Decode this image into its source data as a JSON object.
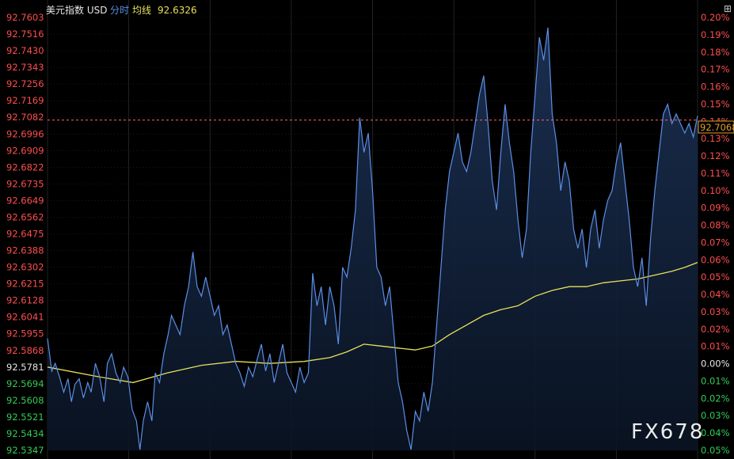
{
  "header": {
    "instrument": "美元指数 USD",
    "mode": "分时",
    "avg_label": "均线",
    "avg_value": "92.6326",
    "button_glyph": "⊞"
  },
  "colors": {
    "background": "#000000",
    "price_line": "#5b8ee6",
    "avg_line": "#e8e05a",
    "up_text": "#ff4d4d",
    "down_text": "#33cc55",
    "neutral_text": "#e6e6e6",
    "grid": "#2a2a2a",
    "ref_line": "#ff6b6b",
    "current_badge": "#e0a028"
  },
  "watermark": "FX678",
  "chart_data": {
    "type": "area",
    "title": "",
    "base_price": 92.5781,
    "current_price": "92.7068",
    "ylim": [
      92.5347,
      92.7603
    ],
    "left_ticks": [
      "92.7603",
      "92.7516",
      "92.7430",
      "92.7343",
      "92.7256",
      "92.7169",
      "92.7082",
      "92.6996",
      "92.6909",
      "92.6822",
      "92.6735",
      "92.6649",
      "92.6562",
      "92.6475",
      "92.6388",
      "92.6302",
      "92.6215",
      "92.6128",
      "92.6041",
      "92.5955",
      "92.5868",
      "92.5781",
      "92.5694",
      "92.5608",
      "92.5521",
      "92.5434",
      "92.5347"
    ],
    "right_ticks": [
      "0.20%",
      "0.19%",
      "0.18%",
      "0.17%",
      "0.16%",
      "0.15%",
      "0.14%",
      "0.13%",
      "0.12%",
      "0.11%",
      "0.10%",
      "0.09%",
      "0.08%",
      "0.07%",
      "0.06%",
      "0.05%",
      "0.04%",
      "0.03%",
      "0.02%",
      "0.01%",
      "0.00%",
      "0.01%",
      "0.02%",
      "0.03%",
      "0.04%",
      "0.05%"
    ],
    "series": [
      {
        "key": "price",
        "points": [
          [
            0,
            92.593
          ],
          [
            5,
            92.576
          ],
          [
            9,
            92.58
          ],
          [
            14,
            92.573
          ],
          [
            19,
            92.565
          ],
          [
            24,
            92.572
          ],
          [
            28,
            92.56
          ],
          [
            32,
            92.569
          ],
          [
            37,
            92.572
          ],
          [
            42,
            92.562
          ],
          [
            47,
            92.57
          ],
          [
            51,
            92.565
          ],
          [
            56,
            92.58
          ],
          [
            61,
            92.573
          ],
          [
            66,
            92.56
          ],
          [
            70,
            92.58
          ],
          [
            75,
            92.585
          ],
          [
            80,
            92.575
          ],
          [
            85,
            92.57
          ],
          [
            89,
            92.578
          ],
          [
            94,
            92.573
          ],
          [
            99,
            92.556
          ],
          [
            104,
            92.55
          ],
          [
            108,
            92.535
          ],
          [
            112,
            92.55
          ],
          [
            117,
            92.56
          ],
          [
            122,
            92.55
          ],
          [
            126,
            92.575
          ],
          [
            131,
            92.57
          ],
          [
            136,
            92.585
          ],
          [
            141,
            92.595
          ],
          [
            145,
            92.605
          ],
          [
            150,
            92.6
          ],
          [
            155,
            92.595
          ],
          [
            160,
            92.61
          ],
          [
            165,
            92.62
          ],
          [
            170,
            92.638
          ],
          [
            175,
            92.62
          ],
          [
            180,
            92.615
          ],
          [
            185,
            92.625
          ],
          [
            190,
            92.615
          ],
          [
            195,
            92.605
          ],
          [
            200,
            92.61
          ],
          [
            205,
            92.595
          ],
          [
            210,
            92.6
          ],
          [
            215,
            92.59
          ],
          [
            220,
            92.58
          ],
          [
            225,
            92.575
          ],
          [
            230,
            92.568
          ],
          [
            235,
            92.578
          ],
          [
            240,
            92.573
          ],
          [
            245,
            92.582
          ],
          [
            250,
            92.59
          ],
          [
            255,
            92.576
          ],
          [
            260,
            92.585
          ],
          [
            265,
            92.57
          ],
          [
            270,
            92.58
          ],
          [
            275,
            92.59
          ],
          [
            280,
            92.575
          ],
          [
            285,
            92.57
          ],
          [
            290,
            92.565
          ],
          [
            295,
            92.578
          ],
          [
            300,
            92.57
          ],
          [
            305,
            92.575
          ],
          [
            310,
            92.627
          ],
          [
            315,
            92.61
          ],
          [
            320,
            92.62
          ],
          [
            325,
            92.6
          ],
          [
            330,
            92.62
          ],
          [
            335,
            92.61
          ],
          [
            340,
            92.59
          ],
          [
            345,
            92.63
          ],
          [
            350,
            92.625
          ],
          [
            355,
            92.64
          ],
          [
            360,
            92.66
          ],
          [
            365,
            92.708
          ],
          [
            370,
            92.69
          ],
          [
            375,
            92.7
          ],
          [
            380,
            92.67
          ],
          [
            385,
            92.63
          ],
          [
            390,
            92.625
          ],
          [
            395,
            92.61
          ],
          [
            400,
            92.62
          ],
          [
            405,
            92.595
          ],
          [
            410,
            92.57
          ],
          [
            415,
            92.56
          ],
          [
            420,
            92.545
          ],
          [
            425,
            92.535
          ],
          [
            430,
            92.555
          ],
          [
            435,
            92.55
          ],
          [
            440,
            92.565
          ],
          [
            445,
            92.555
          ],
          [
            450,
            92.57
          ],
          [
            455,
            92.6
          ],
          [
            460,
            92.63
          ],
          [
            465,
            92.66
          ],
          [
            470,
            92.68
          ],
          [
            475,
            92.69
          ],
          [
            480,
            92.7
          ],
          [
            485,
            92.685
          ],
          [
            490,
            92.68
          ],
          [
            495,
            92.69
          ],
          [
            500,
            92.705
          ],
          [
            505,
            92.72
          ],
          [
            510,
            92.73
          ],
          [
            515,
            92.705
          ],
          [
            520,
            92.675
          ],
          [
            525,
            92.66
          ],
          [
            530,
            92.69
          ],
          [
            535,
            92.715
          ],
          [
            540,
            92.695
          ],
          [
            545,
            92.68
          ],
          [
            550,
            92.655
          ],
          [
            555,
            92.635
          ],
          [
            560,
            92.65
          ],
          [
            565,
            92.69
          ],
          [
            570,
            92.72
          ],
          [
            575,
            92.75
          ],
          [
            580,
            92.738
          ],
          [
            585,
            92.755
          ],
          [
            590,
            92.71
          ],
          [
            595,
            92.695
          ],
          [
            600,
            92.67
          ],
          [
            605,
            92.685
          ],
          [
            610,
            92.675
          ],
          [
            615,
            92.65
          ],
          [
            620,
            92.64
          ],
          [
            625,
            92.65
          ],
          [
            630,
            92.63
          ],
          [
            635,
            92.65
          ],
          [
            640,
            92.66
          ],
          [
            645,
            92.64
          ],
          [
            650,
            92.655
          ],
          [
            655,
            92.665
          ],
          [
            660,
            92.67
          ],
          [
            665,
            92.685
          ],
          [
            670,
            92.695
          ],
          [
            675,
            92.675
          ],
          [
            680,
            92.655
          ],
          [
            685,
            92.63
          ],
          [
            690,
            92.62
          ],
          [
            695,
            92.635
          ],
          [
            700,
            92.61
          ],
          [
            705,
            92.645
          ],
          [
            710,
            92.67
          ],
          [
            715,
            92.69
          ],
          [
            720,
            92.71
          ],
          [
            725,
            92.715
          ],
          [
            730,
            92.705
          ],
          [
            735,
            92.71
          ],
          [
            740,
            92.705
          ],
          [
            745,
            92.7
          ],
          [
            750,
            92.705
          ],
          [
            755,
            92.698
          ],
          [
            760,
            92.709
          ]
        ]
      },
      {
        "key": "average",
        "points": [
          [
            0,
            92.5781
          ],
          [
            60,
            92.573
          ],
          [
            100,
            92.57
          ],
          [
            140,
            92.575
          ],
          [
            180,
            92.579
          ],
          [
            220,
            92.581
          ],
          [
            260,
            92.58
          ],
          [
            300,
            92.581
          ],
          [
            330,
            92.583
          ],
          [
            350,
            92.586
          ],
          [
            370,
            92.59
          ],
          [
            390,
            92.589
          ],
          [
            410,
            92.588
          ],
          [
            430,
            92.587
          ],
          [
            450,
            92.589
          ],
          [
            470,
            92.595
          ],
          [
            490,
            92.6
          ],
          [
            510,
            92.605
          ],
          [
            530,
            92.608
          ],
          [
            550,
            92.61
          ],
          [
            570,
            92.615
          ],
          [
            590,
            92.618
          ],
          [
            610,
            92.62
          ],
          [
            630,
            92.62
          ],
          [
            650,
            92.622
          ],
          [
            670,
            92.623
          ],
          [
            690,
            92.624
          ],
          [
            710,
            92.626
          ],
          [
            730,
            92.628
          ],
          [
            745,
            92.63
          ],
          [
            760,
            92.6326
          ]
        ]
      }
    ],
    "x_range": [
      0,
      760
    ]
  }
}
